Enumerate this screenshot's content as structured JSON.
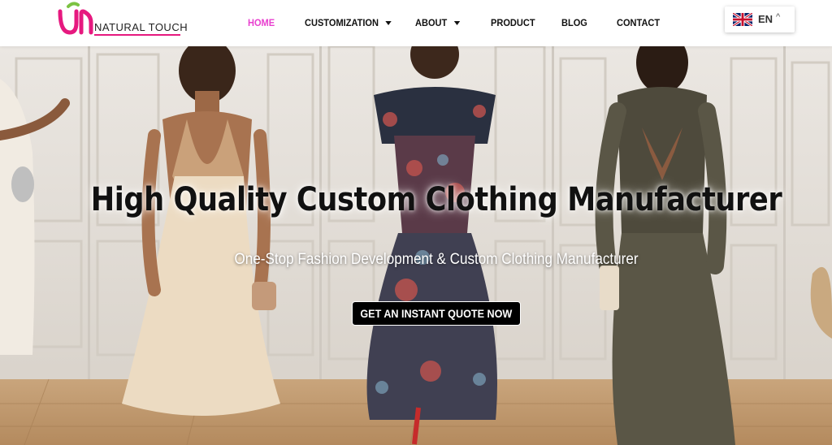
{
  "brand": {
    "logo_mark": "ÚN",
    "name": "NATURAL TOUCH"
  },
  "nav": {
    "items": [
      {
        "label": "HOME",
        "active": true,
        "dropdown": false
      },
      {
        "label": "CUSTOMIZATION",
        "active": false,
        "dropdown": true
      },
      {
        "label": "ABOUT",
        "active": false,
        "dropdown": true
      },
      {
        "label": "PRODUCT",
        "active": false,
        "dropdown": false
      },
      {
        "label": "BLOG",
        "active": false,
        "dropdown": false
      },
      {
        "label": "CONTACT",
        "active": false,
        "dropdown": false
      }
    ]
  },
  "language": {
    "code": "EN",
    "flag_icon": "uk-flag-icon",
    "chevron": "^"
  },
  "hero": {
    "title": "High Quality Custom Clothing Manufacturer",
    "subtitle": "One-Stop Fashion Development & Custom Clothing Manufacturer",
    "cta_label": "GET AN INSTANT QUOTE NOW"
  },
  "colors": {
    "accent_pink": "#e83fcf",
    "logo_pink": "#e6197f",
    "logo_green": "#7cc242",
    "cta_bg": "#000000"
  }
}
